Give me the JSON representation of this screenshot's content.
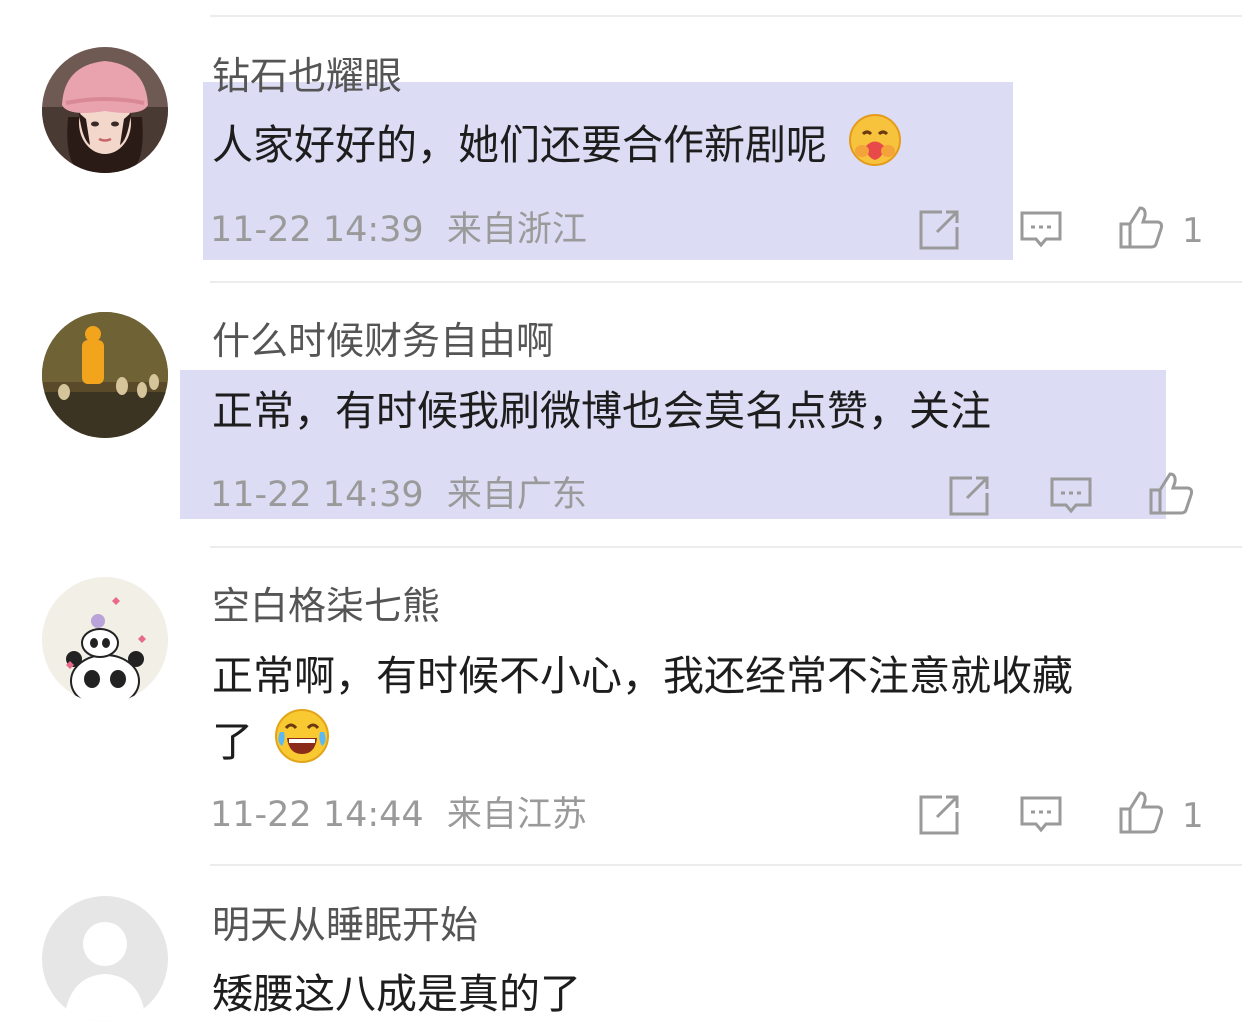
{
  "comments": [
    {
      "user": "钻石也耀眼",
      "text": "人家好好的，她们还要合作新剧呢",
      "emoji": "hugging-face-emoji",
      "time": "11-22 14:39",
      "location": "来自浙江",
      "likes": "1"
    },
    {
      "user": "什么时候财务自由啊",
      "text": "正常，有时候我刷微博也会莫名点赞，关注",
      "time": "11-22 14:39",
      "location": "来自广东",
      "likes": ""
    },
    {
      "user": "空白格柒七熊",
      "text_line1": "正常啊，有时候不小心，我还经常不注意就收藏",
      "text_line2": "了",
      "emoji": "laughing-tears-emoji",
      "time": "11-22 14:44",
      "location": "来自江苏",
      "likes": "1"
    },
    {
      "user": "明天从睡眠开始",
      "text": "矮腰这八成是真的了"
    }
  ],
  "colors": {
    "highlight": "#dcdcf4",
    "username": "#555555",
    "meta": "#9a9a9a",
    "text": "#1d1d1d"
  }
}
